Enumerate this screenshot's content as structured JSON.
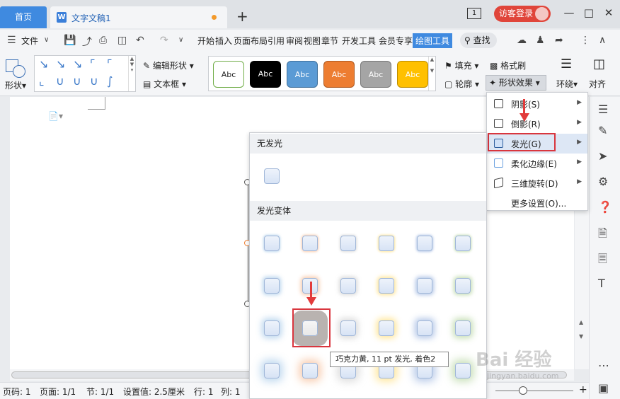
{
  "titlebar": {
    "home_tab": "首页",
    "doc_tab": "文字文稿1",
    "doc_icon": "W",
    "new_tab": "+",
    "window_count": "1",
    "login": "访客登录"
  },
  "menu": {
    "file": "文件",
    "items": [
      "开始",
      "插入",
      "页面布局",
      "引用",
      "审阅",
      "视图",
      "章节",
      "开发工具",
      "会员专享",
      "绘图工具"
    ],
    "search": "查找"
  },
  "ribbon": {
    "shape": "形状",
    "edit_shape": "编辑形状",
    "text_box": "文本框",
    "style_buttons": [
      "Abc",
      "Abc",
      "Abc",
      "Abc",
      "Abc",
      "Abc"
    ],
    "fill": "填充",
    "format_painter": "格式刷",
    "outline": "轮廓",
    "shape_effects": "形状效果",
    "wrap": "环绕",
    "align": "对齐"
  },
  "effects_menu": {
    "items": [
      {
        "label": "阴影(S)"
      },
      {
        "label": "倒影(R)"
      },
      {
        "label": "发光(G)"
      },
      {
        "label": "柔化边缘(E)"
      },
      {
        "label": "三维旋转(D)"
      },
      {
        "label": "更多设置(O)..."
      }
    ]
  },
  "glow_panel": {
    "no_glow": "无发光",
    "variants": "发光变体",
    "tooltip": "巧克力黄, 11 pt 发光, 着色2"
  },
  "statusbar": {
    "page_num": "页码: 1",
    "pages": "页面: 1/1",
    "section": "节: 1/1",
    "setting": "设置值: 2.5厘米",
    "row": "行: 1",
    "col": "列: 1"
  },
  "watermark": {
    "logo": "Bai 经验",
    "url": "jingyan.baidu.com"
  },
  "colors": {
    "accent": "#3f8ae0",
    "login_red": "#e0453a",
    "highlight_red": "#d9363e",
    "style_colors": [
      "#ffffff",
      "#000000",
      "#5b9bd5",
      "#ed7d31",
      "#a5a5a5",
      "#ffc000"
    ],
    "glow_columns": [
      "#5b9bd5",
      "#ed7d31",
      "#a5a5a5",
      "#ffc000",
      "#4472c4",
      "#70ad47"
    ]
  }
}
